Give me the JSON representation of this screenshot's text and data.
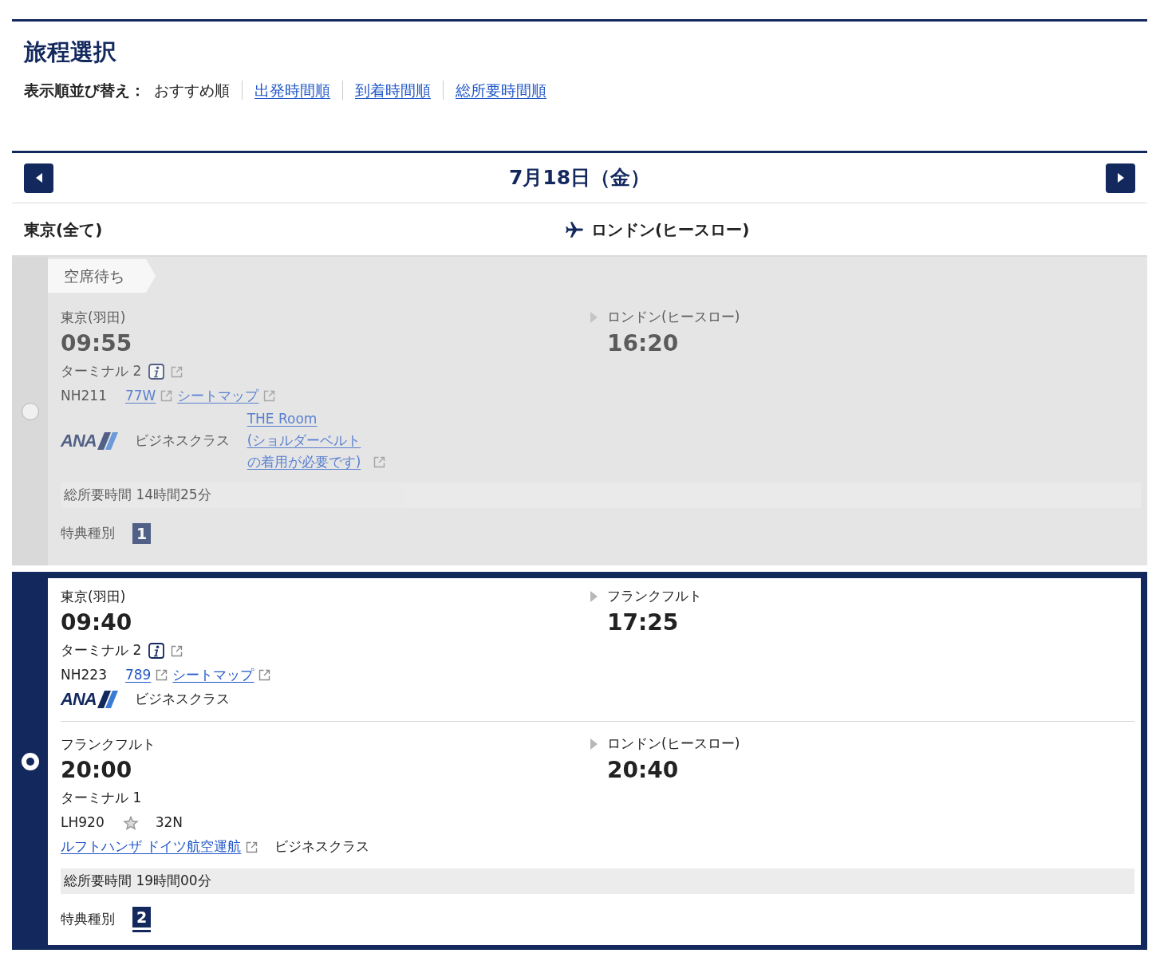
{
  "title": "旅程選択",
  "sort": {
    "label": "表示順並び替え：",
    "options": [
      {
        "label": "おすすめ順",
        "selected": true
      },
      {
        "label": "出発時間順",
        "selected": false
      },
      {
        "label": "到着時間順",
        "selected": false
      },
      {
        "label": "総所要時間順",
        "selected": false
      }
    ]
  },
  "date_nav": {
    "date": "7月18日（金）"
  },
  "route": {
    "origin": "東京(全て)",
    "destination": "ロンドン(ヒースロー)"
  },
  "options": [
    {
      "selected": false,
      "disabled": true,
      "status_tag": "空席待ち",
      "segments": [
        {
          "departure": {
            "airport": "東京(羽田)",
            "time": "09:55",
            "terminal": "ターミナル 2",
            "terminal_info": true
          },
          "arrival": {
            "airport": "ロンドン(ヒースロー)",
            "time": "16:20"
          },
          "flight_number": "NH211",
          "alliance_mark": false,
          "aircraft": {
            "label": "77W",
            "link": true
          },
          "seat_map": "シートマップ",
          "carrier": {
            "kind": "logo",
            "label": "ANA"
          },
          "cabin": "ビジネスクラス",
          "seat_product": "THE Room\n(ショルダーベルトの着用が必要です)"
        }
      ],
      "total": "総所要時間 14時間25分",
      "award": {
        "label": "特典種別",
        "type": "1"
      }
    },
    {
      "selected": true,
      "disabled": false,
      "segments": [
        {
          "departure": {
            "airport": "東京(羽田)",
            "time": "09:40",
            "terminal": "ターミナル 2",
            "terminal_info": true
          },
          "arrival": {
            "airport": "フランクフルト",
            "time": "17:25"
          },
          "flight_number": "NH223",
          "alliance_mark": false,
          "aircraft": {
            "label": "789",
            "link": true
          },
          "seat_map": "シートマップ",
          "carrier": {
            "kind": "logo",
            "label": "ANA"
          },
          "cabin": "ビジネスクラス"
        },
        {
          "departure": {
            "airport": "フランクフルト",
            "time": "20:00",
            "terminal": "ターミナル 1",
            "terminal_info": false
          },
          "arrival": {
            "airport": "ロンドン(ヒースロー)",
            "time": "20:40"
          },
          "flight_number": "LH920",
          "alliance_mark": true,
          "aircraft": {
            "label": "32N",
            "link": false
          },
          "carrier": {
            "kind": "operated_by",
            "label": "ルフトハンザ ドイツ航空運航"
          },
          "cabin": "ビジネスクラス"
        }
      ],
      "total": "総所要時間 19時間00分",
      "award": {
        "label": "特典種別",
        "type": "2"
      }
    }
  ]
}
